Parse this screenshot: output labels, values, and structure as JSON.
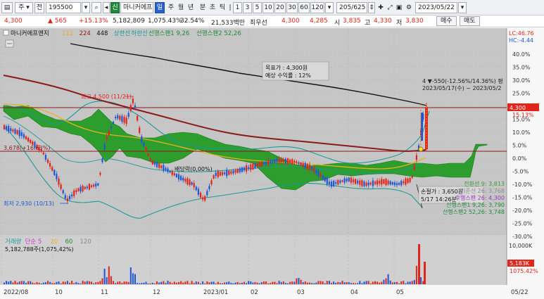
{
  "toolbar": {
    "stock_type": "주",
    "all_label": "전",
    "code": "195500",
    "tag_new": "신",
    "stock_name": "마니커에프",
    "period_selected": "일",
    "periods": [
      "주",
      "월",
      "년",
      "분",
      "초",
      "틱"
    ],
    "intervals": [
      "1",
      "3",
      "5",
      "10",
      "20",
      "30",
      "60",
      "120"
    ],
    "page_counter": "205/625",
    "date": "2023/05/22"
  },
  "quote": {
    "price": "4,300",
    "change": "▲ 565",
    "change_pct": "+15.13%",
    "volume": "5,182,809",
    "volume_ratio": "1,075.43%",
    "turnover_ratio": "32.54%",
    "amount": "21,533백만",
    "best_quote_label": "최우선",
    "best_ask": "4,300",
    "best_bid": "4,285",
    "open_label": "시",
    "open": "3,835",
    "high_label": "고",
    "high": "4,330",
    "low_label": "저",
    "low": "3,830",
    "buy_label": "매수",
    "sell_label": "매도"
  },
  "legend": {
    "name": "마니커에프앤지",
    "items": [
      {
        "text": "112",
        "color": "#e8b21c"
      },
      {
        "text": "224",
        "color": "#8b1a1a"
      },
      {
        "text": "448",
        "color": "#111111"
      },
      {
        "text": "상한선",
        "color": "#1a9a9a"
      },
      {
        "text": "하한선",
        "color": "#1a9a9a"
      },
      {
        "text": "선행스팬1 9,26",
        "color": "#1f8a3a"
      },
      {
        "text": "선행스팬2 52,26",
        "color": "#1f8a3a"
      }
    ]
  },
  "annotations": {
    "target_line1": "목표가 : 4,300원",
    "target_line2": "예상 수익률 : 12%",
    "high_marker": "최고 4,500 (11/21)",
    "low_marker": "최저 2,930 (10/13)",
    "left_level": "3,678(+16.63%)",
    "dividend": "배당락(0,00%)",
    "trend_line1": "4 ▼-550(-12.56%/14.36%) 평",
    "trend_line2": "2023/05/17(수) ~ 2023/05/2",
    "stoploss_line1": "손절가 : 3,650원",
    "stoploss_line2": "5/17 14:26분"
  },
  "right_labels": {
    "lc": "LC:46.76",
    "hc": "HC:-4.44",
    "price_tag": "4,300",
    "pct_tag": "15.13%",
    "vol_tag": "5,183K",
    "vol_pct_tag": "1075.42%",
    "span_values": [
      {
        "text": "전환선 9: 3,813",
        "color": "#3d9a3d"
      },
      {
        "text": "기준선 26: 3,768",
        "color": "#8a8a8a"
      },
      {
        "text": "후행스팬 26: 4,300",
        "color": "#9a3dbf"
      },
      {
        "text": "선행스팬1 9,26: 3,790",
        "color": "#1f8a3a"
      },
      {
        "text": "선행스팬2 52,26: 3,748",
        "color": "#1f8a3a"
      }
    ]
  },
  "volume_panel": {
    "legend_items": [
      {
        "text": "거래량",
        "color": "#1a9a9a"
      },
      {
        "text": "단순 5",
        "color": "#d43ad4"
      },
      {
        "text": "20",
        "color": "#e8b21c"
      },
      {
        "text": "60",
        "color": "#1f8a3a"
      },
      {
        "text": "120",
        "color": "#888888"
      }
    ],
    "summary": "5,182,788주(1,075,42%)",
    "axis_label": "10,000K"
  },
  "chart_data": {
    "type": "candlestick",
    "price_axis_pct": [
      "40.0%",
      "35.0%",
      "30.0%",
      "25.0%",
      "20.0%",
      "15.0%",
      "10.0%",
      "5.0%",
      "0.0%",
      "-5.0%",
      "-10.0%",
      "-15.0%",
      "-20.0%",
      "-25.0%",
      "-30.0%"
    ],
    "x_labels": [
      "2022/08",
      "10",
      "11",
      "12",
      "2023/01",
      "02",
      "03",
      "04",
      "05"
    ],
    "x_axis_end_label": "05/22",
    "last_price": 4300,
    "high": {
      "value": 4500,
      "date": "11/21"
    },
    "low": {
      "value": 2930,
      "date": "10/13"
    },
    "target_price": 4300,
    "stop_loss": 3650,
    "colors": {
      "up": "#e0251b",
      "down": "#1f55d6",
      "cloud": "#1f9a1f",
      "ma112": "#e8b21c",
      "ma224": "#8b1a1a",
      "ma448": "#111111",
      "band": "#1a9a9a"
    }
  }
}
